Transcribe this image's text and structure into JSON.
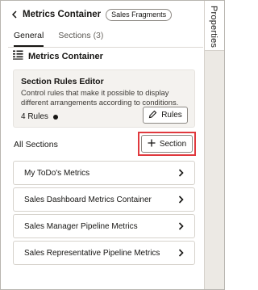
{
  "header": {
    "title": "Metrics Container",
    "chip": "Sales Fragments",
    "back_icon": "chevron-left-icon"
  },
  "tabs": [
    {
      "label": "General",
      "active": true
    },
    {
      "label": "Sections",
      "count": "(3)",
      "active": false
    }
  ],
  "component": {
    "title": "Metrics Container",
    "icon": "metrics-container-icon"
  },
  "rules_editor": {
    "title": "Section Rules Editor",
    "description": "Control rules that make it possible to display different arrangements according to conditions.",
    "count": "4 Rules",
    "button_label": "Rules",
    "button_icon": "pencil-icon"
  },
  "sections": {
    "header": "All Sections",
    "add_label": "Section",
    "add_icon": "plus-icon",
    "highlight_color": "#e0393e",
    "items": [
      {
        "label": "My ToDo's Metrics"
      },
      {
        "label": "Sales Dashboard Metrics Container"
      },
      {
        "label": "Sales Manager Pipeline Metrics"
      },
      {
        "label": "Sales Representative Pipeline Metrics"
      }
    ]
  },
  "side_rail": {
    "tab_label": "Properties"
  }
}
